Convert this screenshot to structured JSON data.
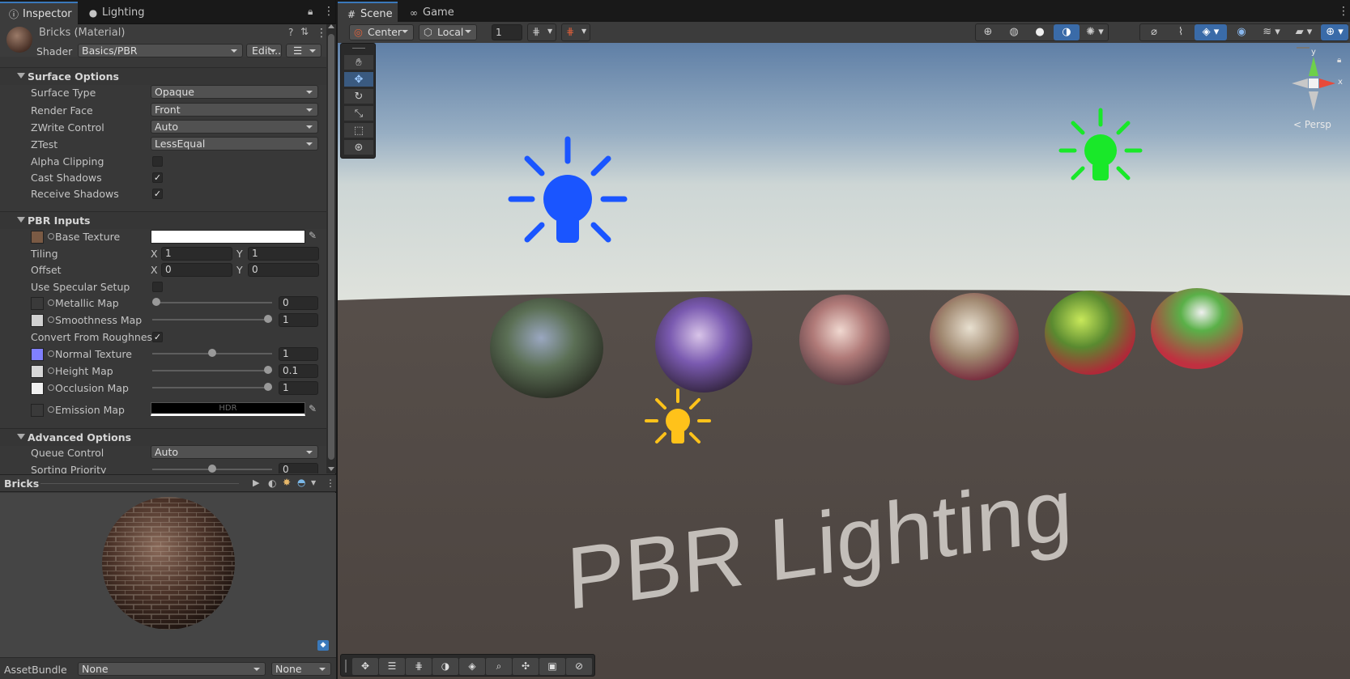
{
  "inspector": {
    "tabs": [
      {
        "label": "Inspector",
        "icon": "info-icon"
      },
      {
        "label": "Lighting",
        "icon": "bulb-icon"
      }
    ],
    "material_name": "Bricks (Material)",
    "shader_label": "Shader",
    "shader_value": "Basics/PBR",
    "edit_label": "Edit...",
    "sections": {
      "surface": "Surface Options",
      "pbr": "PBR Inputs",
      "advanced": "Advanced Options"
    },
    "surface": {
      "surface_type": {
        "label": "Surface Type",
        "value": "Opaque"
      },
      "render_face": {
        "label": "Render Face",
        "value": "Front"
      },
      "zwrite": {
        "label": "ZWrite Control",
        "value": "Auto"
      },
      "ztest": {
        "label": "ZTest",
        "value": "LessEqual"
      },
      "alpha_clipping": {
        "label": "Alpha Clipping",
        "checked": false
      },
      "cast_shadows": {
        "label": "Cast Shadows",
        "checked": true
      },
      "receive_shadows": {
        "label": "Receive Shadows",
        "checked": true
      }
    },
    "pbr": {
      "base_texture": "Base Texture",
      "tiling": {
        "label": "Tiling",
        "x_label": "X",
        "y_label": "Y",
        "x": "1",
        "y": "1"
      },
      "offset": {
        "label": "Offset",
        "x_label": "X",
        "y_label": "Y",
        "x": "0",
        "y": "0"
      },
      "use_specular": {
        "label": "Use Specular Setup",
        "checked": false
      },
      "metallic": {
        "label": "Metallic Map",
        "value": "0",
        "level": 0.0
      },
      "smoothness": {
        "label": "Smoothness Map",
        "value": "1",
        "level": 1.0
      },
      "convert_roughness": {
        "label": "Convert From Roughness",
        "checked": true
      },
      "normal": {
        "label": "Normal Texture",
        "value": "1",
        "level": 0.5
      },
      "height": {
        "label": "Height Map",
        "value": "0.1",
        "level": 1.0
      },
      "occlusion": {
        "label": "Occlusion Map",
        "value": "1",
        "level": 1.0
      },
      "emission": {
        "label": "Emission Map",
        "hdr": "HDR"
      }
    },
    "advanced": {
      "queue": {
        "label": "Queue Control",
        "value": "Auto"
      },
      "sorting": {
        "label": "Sorting Priority",
        "value": "0",
        "level": 0.5
      }
    },
    "preview_title": "Bricks",
    "assetbundle_label": "AssetBundle",
    "assetbundle_value": "None",
    "assetbundle_variant": "None"
  },
  "scene": {
    "tabs": [
      {
        "label": "Scene",
        "icon": "grid-icon"
      },
      {
        "label": "Game",
        "icon": "gamepad-icon"
      }
    ],
    "pivot_mode": "Center",
    "pivot_rotation": "Local",
    "grid_size": "1",
    "persp_label": "< Persp",
    "gizmo_axes": {
      "x": "x",
      "y": "y"
    },
    "text_3d": "PBR Lighting"
  },
  "colors": {
    "accent": "#3a79bb",
    "blue_light": "#1a55ff",
    "green_light": "#19e829",
    "yellow_light": "#ffc21a"
  }
}
